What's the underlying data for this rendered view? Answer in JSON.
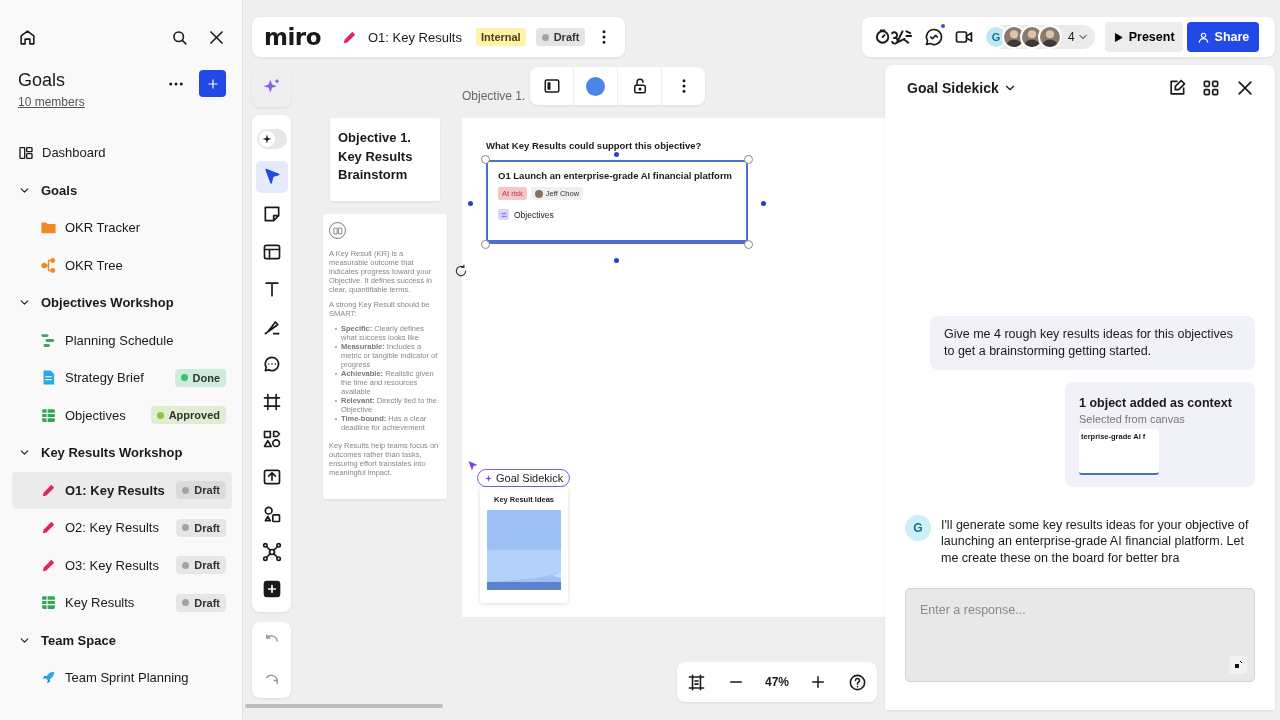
{
  "sidebar": {
    "title": "Goals",
    "members": "10 members",
    "nav": [
      {
        "kind": "dashboard",
        "label": "Dashboard"
      },
      {
        "kind": "section",
        "label": "Goals",
        "expanded": true,
        "children": [
          {
            "kind": "folder",
            "label": "OKR Tracker",
            "selected": false
          },
          {
            "kind": "tree",
            "label": "OKR Tree",
            "selected": false
          }
        ]
      },
      {
        "kind": "section",
        "label": "Objectives Workshop",
        "expanded": true,
        "children": [
          {
            "kind": "timeline",
            "label": "Planning Schedule",
            "selected": false
          },
          {
            "kind": "doc",
            "label": "Strategy Brief",
            "selected": false,
            "badge": {
              "text": "Done",
              "color": "#3dbf6e"
            }
          },
          {
            "kind": "table",
            "label": "Objectives",
            "selected": false,
            "badge": {
              "text": "Approved",
              "color": "#8cc63f"
            }
          }
        ]
      },
      {
        "kind": "section",
        "label": "Key Results Workshop",
        "expanded": true,
        "children": [
          {
            "kind": "pencil",
            "label": "O1: Key Results",
            "selected": true,
            "badge": {
              "text": "Draft",
              "color": "#a3a3a3"
            }
          },
          {
            "kind": "pencil",
            "label": "O2: Key Results",
            "selected": false,
            "badge": {
              "text": "Draft",
              "color": "#a3a3a3"
            }
          },
          {
            "kind": "pencil",
            "label": "O3: Key Results",
            "selected": false,
            "badge": {
              "text": "Draft",
              "color": "#a3a3a3"
            }
          },
          {
            "kind": "table",
            "label": "Key Results",
            "selected": false,
            "badge": {
              "text": "Draft",
              "color": "#a3a3a3"
            }
          }
        ]
      },
      {
        "kind": "section",
        "label": "Team Space",
        "expanded": true,
        "children": [
          {
            "kind": "rocket",
            "label": "Team Sprint Planning",
            "selected": false
          }
        ]
      }
    ]
  },
  "board_header": {
    "logo": "miro",
    "title": "O1: Key Results",
    "tag": "Internal",
    "status": {
      "text": "Draft",
      "color": "#a3a3a3"
    }
  },
  "collaboration": {
    "chat_unread": true,
    "avatars": [
      {
        "kind": "initial",
        "initial": "G"
      },
      {
        "kind": "photo"
      },
      {
        "kind": "photo"
      },
      {
        "kind": "photo"
      }
    ],
    "count": "4",
    "present": "Present",
    "share": "Share"
  },
  "tools": [
    {
      "kind": "ai-toggle",
      "selected": false
    },
    {
      "kind": "select",
      "selected": true
    },
    {
      "kind": "sticky",
      "selected": false
    },
    {
      "kind": "table",
      "selected": false
    },
    {
      "kind": "text",
      "selected": false
    },
    {
      "kind": "pen",
      "selected": false
    },
    {
      "kind": "comment",
      "selected": false
    },
    {
      "kind": "frame",
      "selected": false
    },
    {
      "kind": "shapes",
      "selected": false
    },
    {
      "kind": "upload",
      "selected": false
    },
    {
      "kind": "diagram",
      "selected": false
    },
    {
      "kind": "mindmap",
      "selected": false
    },
    {
      "kind": "add",
      "selected": false
    }
  ],
  "canvas": {
    "frame_title": "Objective 1.",
    "title_card": "Objective 1. Key Results Brainstorm",
    "info_card": {
      "paragraphs": [
        "A Key Result (KR) is a measurable outcome that indicates progress toward your Objective. It defines success in clear, quantifiable terms.",
        "A strong Key Result should be SMART:"
      ],
      "bullets": [
        "**Specific:** Clearly defines what success looks like",
        "**Measurable:** Includes a metric or tangible indicator of progress",
        "**Achievable:** Realistic given the time and resources available",
        "**Relevant:** Directly tied to the Objective",
        "**Time-bound:** Has a clear deadline for achievement"
      ],
      "closing": "Key Results help teams focus on outcomes rather than tasks, ensuring effort translates into meaningful impact."
    },
    "question": "What Key Results could support this objective?",
    "objective_card": {
      "title": "O1 Launch an enterprise-grade AI financial platform",
      "status": "At risk",
      "owner": "Jeff Chow",
      "link": "Objectives",
      "selected": true
    },
    "cursor_label": "Goal Sidekick",
    "ideas_card": {
      "title": "Key Result Ideas"
    }
  },
  "zoom": {
    "value": "47%"
  },
  "sidekick": {
    "title": "Goal Sidekick",
    "messages": [
      {
        "kind": "user",
        "text": "Give me 4 rough key results ideas for this objectives to get a brainstorming getting started."
      },
      {
        "kind": "context",
        "title": "1 object added as context",
        "subtitle": "Selected from canvas",
        "preview": "terprise-grade AI f"
      },
      {
        "kind": "assistant",
        "avatar": "G",
        "text": "I'll generate some key results ideas for your objective of launching an enterprise-grade AI financial platform. Let me create these on the board for better bra"
      }
    ],
    "input": {
      "placeholder": "Enter a response..."
    }
  }
}
